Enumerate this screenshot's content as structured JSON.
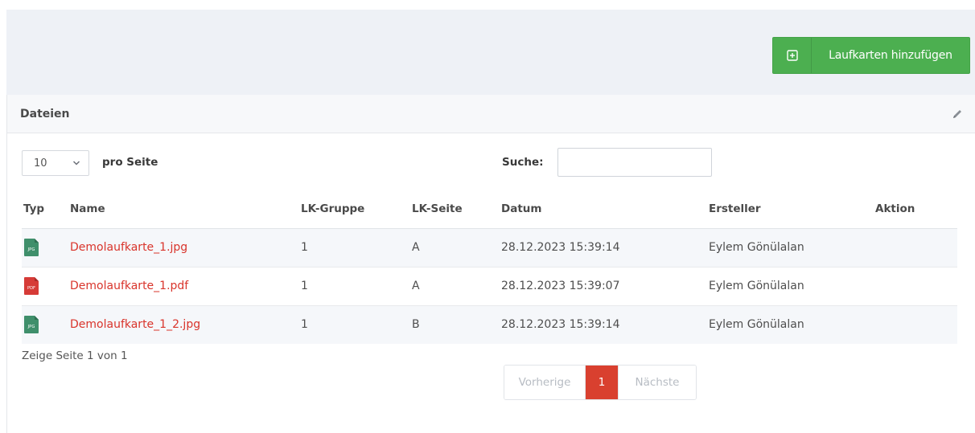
{
  "toolbar": {
    "add_label": "Laufkarten hinzufügen"
  },
  "panel": {
    "title": "Dateien"
  },
  "controls": {
    "per_page_value": "10",
    "per_page_label": "pro Seite",
    "search_label": "Suche:",
    "search_value": ""
  },
  "table": {
    "headers": [
      "Typ",
      "Name",
      "LK-Gruppe",
      "LK-Seite",
      "Datum",
      "Ersteller",
      "Aktion"
    ],
    "rows": [
      {
        "type": "JPG",
        "icon": "jpg-file-icon",
        "name": "Demolaufkarte_1.jpg",
        "gruppe": "1",
        "seite": "A",
        "datum": "28.12.2023 15:39:14",
        "ersteller": "Eylem Gönülalan"
      },
      {
        "type": "PDF",
        "icon": "pdf-file-icon",
        "name": "Demolaufkarte_1.pdf",
        "gruppe": "1",
        "seite": "A",
        "datum": "28.12.2023 15:39:07",
        "ersteller": "Eylem Gönülalan"
      },
      {
        "type": "JPG",
        "icon": "jpg-file-icon",
        "name": "Demolaufkarte_1_2.jpg",
        "gruppe": "1",
        "seite": "B",
        "datum": "28.12.2023 15:39:14",
        "ersteller": "Eylem Gönülalan"
      }
    ]
  },
  "pagination": {
    "info": "Zeige Seite 1 von 1",
    "prev_label": "Vorherige",
    "current": "1",
    "next_label": "Nächste"
  },
  "colors": {
    "accent_green": "#4caf50",
    "link_red": "#d9342b",
    "jpg_icon": "#3f8f6b",
    "pdf_icon": "#d63b37",
    "active_page": "#d9402f"
  }
}
